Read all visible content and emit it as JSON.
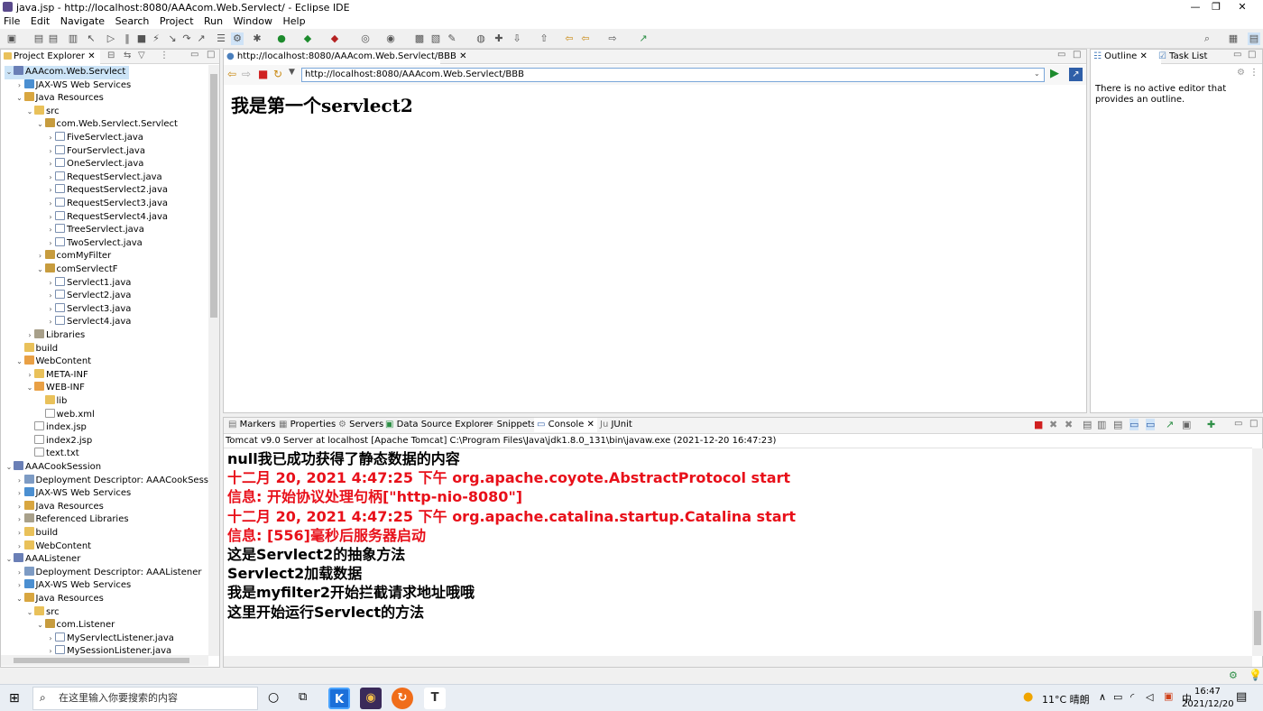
{
  "window": {
    "title": "java.jsp - http://localhost:8080/AAAcom.Web.Servlect/ - Eclipse IDE",
    "controls": [
      "—",
      "❐",
      "✕"
    ]
  },
  "menu": [
    "File",
    "Edit",
    "Navigate",
    "Search",
    "Project",
    "Run",
    "Window",
    "Help"
  ],
  "project_explorer": {
    "tab_label": "Project Explorer",
    "tree": [
      {
        "label": "AAAcom.Web.Servlect",
        "indent": 0,
        "tw": "v",
        "icon": "proj",
        "selected": true
      },
      {
        "label": "JAX-WS Web Services",
        "indent": 1,
        "tw": ">",
        "icon": "ws"
      },
      {
        "label": "Java Resources",
        "indent": 1,
        "tw": "v",
        "icon": "src"
      },
      {
        "label": "src",
        "indent": 2,
        "tw": "v",
        "icon": "folder"
      },
      {
        "label": "com.Web.Servlect.Servlect",
        "indent": 3,
        "tw": "v",
        "icon": "pkg"
      },
      {
        "label": "FiveServlect.java",
        "indent": 4,
        "tw": ">",
        "icon": "java"
      },
      {
        "label": "FourServlect.java",
        "indent": 4,
        "tw": ">",
        "icon": "java"
      },
      {
        "label": "OneServlect.java",
        "indent": 4,
        "tw": ">",
        "icon": "java"
      },
      {
        "label": "RequestServlect.java",
        "indent": 4,
        "tw": ">",
        "icon": "java"
      },
      {
        "label": "RequestServlect2.java",
        "indent": 4,
        "tw": ">",
        "icon": "java"
      },
      {
        "label": "RequestServlect3.java",
        "indent": 4,
        "tw": ">",
        "icon": "java"
      },
      {
        "label": "RequestServlect4.java",
        "indent": 4,
        "tw": ">",
        "icon": "java"
      },
      {
        "label": "TreeServlect.java",
        "indent": 4,
        "tw": ">",
        "icon": "java"
      },
      {
        "label": "TwoServlect.java",
        "indent": 4,
        "tw": ">",
        "icon": "java"
      },
      {
        "label": "comMyFilter",
        "indent": 3,
        "tw": ">",
        "icon": "pkg"
      },
      {
        "label": "comServlectF",
        "indent": 3,
        "tw": "v",
        "icon": "pkg"
      },
      {
        "label": "Servlect1.java",
        "indent": 4,
        "tw": ">",
        "icon": "java"
      },
      {
        "label": "Servlect2.java",
        "indent": 4,
        "tw": ">",
        "icon": "java"
      },
      {
        "label": "Servlect3.java",
        "indent": 4,
        "tw": ">",
        "icon": "java"
      },
      {
        "label": "Servlect4.java",
        "indent": 4,
        "tw": ">",
        "icon": "java"
      },
      {
        "label": "Libraries",
        "indent": 2,
        "tw": ">",
        "icon": "lib"
      },
      {
        "label": "build",
        "indent": 1,
        "tw": "",
        "icon": "folder"
      },
      {
        "label": "WebContent",
        "indent": 1,
        "tw": "v",
        "icon": "wc"
      },
      {
        "label": "META-INF",
        "indent": 2,
        "tw": ">",
        "icon": "folder"
      },
      {
        "label": "WEB-INF",
        "indent": 2,
        "tw": "v",
        "icon": "wc"
      },
      {
        "label": "lib",
        "indent": 3,
        "tw": "",
        "icon": "folder"
      },
      {
        "label": "web.xml",
        "indent": 3,
        "tw": "",
        "icon": "file"
      },
      {
        "label": "index.jsp",
        "indent": 2,
        "tw": "",
        "icon": "file"
      },
      {
        "label": "index2.jsp",
        "indent": 2,
        "tw": "",
        "icon": "file"
      },
      {
        "label": "text.txt",
        "indent": 2,
        "tw": "",
        "icon": "file"
      },
      {
        "label": "AAACookSession",
        "indent": 0,
        "tw": "v",
        "icon": "proj"
      },
      {
        "label": "Deployment Descriptor: AAACookSession",
        "indent": 1,
        "tw": ">",
        "icon": "dd"
      },
      {
        "label": "JAX-WS Web Services",
        "indent": 1,
        "tw": ">",
        "icon": "ws"
      },
      {
        "label": "Java Resources",
        "indent": 1,
        "tw": ">",
        "icon": "src"
      },
      {
        "label": "Referenced Libraries",
        "indent": 1,
        "tw": ">",
        "icon": "lib"
      },
      {
        "label": "build",
        "indent": 1,
        "tw": ">",
        "icon": "folder"
      },
      {
        "label": "WebContent",
        "indent": 1,
        "tw": ">",
        "icon": "folder"
      },
      {
        "label": "AAAListener",
        "indent": 0,
        "tw": "v",
        "icon": "proj"
      },
      {
        "label": "Deployment Descriptor: AAAListener",
        "indent": 1,
        "tw": ">",
        "icon": "dd"
      },
      {
        "label": "JAX-WS Web Services",
        "indent": 1,
        "tw": ">",
        "icon": "ws"
      },
      {
        "label": "Java Resources",
        "indent": 1,
        "tw": "v",
        "icon": "src"
      },
      {
        "label": "src",
        "indent": 2,
        "tw": "v",
        "icon": "folder"
      },
      {
        "label": "com.Listener",
        "indent": 3,
        "tw": "v",
        "icon": "pkg"
      },
      {
        "label": "MyServlectListener.java",
        "indent": 4,
        "tw": ">",
        "icon": "java"
      },
      {
        "label": "MySessionListener.java",
        "indent": 4,
        "tw": ">",
        "icon": "java"
      }
    ]
  },
  "browser": {
    "tab_label": "http://localhost:8080/AAAcom.Web.Servlect/BBB",
    "url": "http://localhost:8080/AAAcom.Web.Servlect/BBB",
    "page_text": "我是第一个servlect2"
  },
  "outline": {
    "tabs": [
      "Outline",
      "Task List"
    ],
    "message": "There is no active editor that provides an outline."
  },
  "console": {
    "tabs": [
      "Markers",
      "Properties",
      "Servers",
      "Data Source Explorer",
      "Snippets",
      "Console",
      "JUnit"
    ],
    "header": "Tomcat v9.0 Server at localhost [Apache Tomcat] C:\\Program Files\\Java\\jdk1.8.0_131\\bin\\javaw.exe  (2021-12-20 16:47:23)",
    "lines": [
      {
        "text": "null我已成功获得了静态数据的内容",
        "red": false
      },
      {
        "text": "十二月 20, 2021 4:47:25 下午 org.apache.coyote.AbstractProtocol start",
        "red": true
      },
      {
        "text": "信息: 开始协议处理句柄[\"http-nio-8080\"]",
        "red": true
      },
      {
        "text": "十二月 20, 2021 4:47:25 下午 org.apache.catalina.startup.Catalina start",
        "red": true
      },
      {
        "text": "信息: [556]毫秒后服务器启动",
        "red": true
      },
      {
        "text": "这是Servlect2的抽象方法",
        "red": false
      },
      {
        "text": "Servlect2加载数据",
        "red": false
      },
      {
        "text": "我是myfilter2开始拦截请求地址哦哦",
        "red": false
      },
      {
        "text": "这里开始运行Servlect的方法",
        "red": false
      }
    ]
  },
  "taskbar": {
    "search_placeholder": "在这里输入你要搜索的内容",
    "weather": "11°C 晴朗",
    "ime": "中",
    "time": "16:47",
    "date": "2021/12/20"
  },
  "colors": {
    "accent": "#0078d7",
    "error_red": "#e8101a"
  }
}
